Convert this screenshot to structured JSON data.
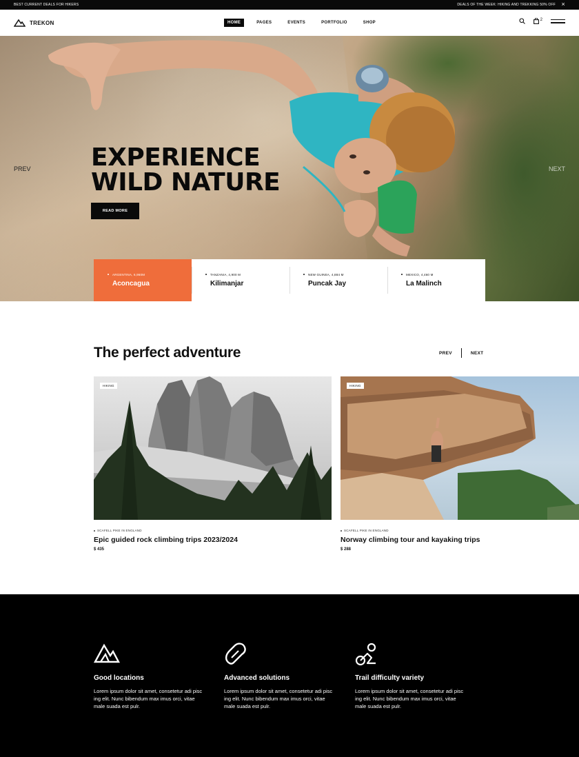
{
  "topbar": {
    "left_text": "BEST CURRENT DEALS FOR HIKERS",
    "right_text": "DEALS OF THE WEEK: HIKING AND TREKKING 50% OFF",
    "close_icon": "close-icon"
  },
  "header": {
    "logo_text": "TREKON",
    "nav": [
      "HOME",
      "PAGES",
      "EVENTS",
      "PORTFOLIO",
      "SHOP"
    ],
    "active_nav": "HOME",
    "cart_count": "2"
  },
  "hero": {
    "title_line1": "EXPERIENCE",
    "title_line2": "WILD NATURE",
    "cta": "READ MORE",
    "prev": "PREV",
    "next": "NEXT",
    "peaks": [
      {
        "location": "ARGENTINA, 6,960M",
        "name": "Aconcagua"
      },
      {
        "location": "TANZANIA, 4,900 M",
        "name": "Kilimanjar"
      },
      {
        "location": "NEW GUINEA, 4,884 M",
        "name": "Puncak Jay"
      },
      {
        "location": "MEXICO, 4,460 M",
        "name": "La Malinch"
      }
    ],
    "colors": {
      "accent": "#ef6d3b"
    }
  },
  "adventure": {
    "title": "The perfect adventure",
    "prev": "PREV",
    "next": "NEXT",
    "cards": [
      {
        "tag": "HIKING",
        "location": "SCAFELL PIKE IN ENGLAND",
        "title": "Epic guided rock climbing trips 2023/2024",
        "price": "$ 435"
      },
      {
        "tag": "HIKING",
        "location": "SCAFELL PIKE IN ENGLAND",
        "title": "Norway climbing tour and kayaking trips",
        "price": "$ 288"
      }
    ]
  },
  "features": [
    {
      "icon": "mountain-icon",
      "title": "Good locations",
      "text": "Lorem ipsum dolor sit amet, consetetur adi pisc ing elit. Nunc bibendum max imus orci, vitae male suada est pulr."
    },
    {
      "icon": "carabiner-icon",
      "title": "Advanced solutions",
      "text": "Lorem ipsum dolor sit amet, consetetur adi pisc ing elit. Nunc bibendum max imus orci, vitae male suada est pulr."
    },
    {
      "icon": "trail-icon",
      "title": "Trail difficulty variety",
      "text": "Lorem ipsum dolor sit amet, consetetur adi pisc ing elit. Nunc bibendum max imus orci, vitae male suada est pulr."
    }
  ]
}
